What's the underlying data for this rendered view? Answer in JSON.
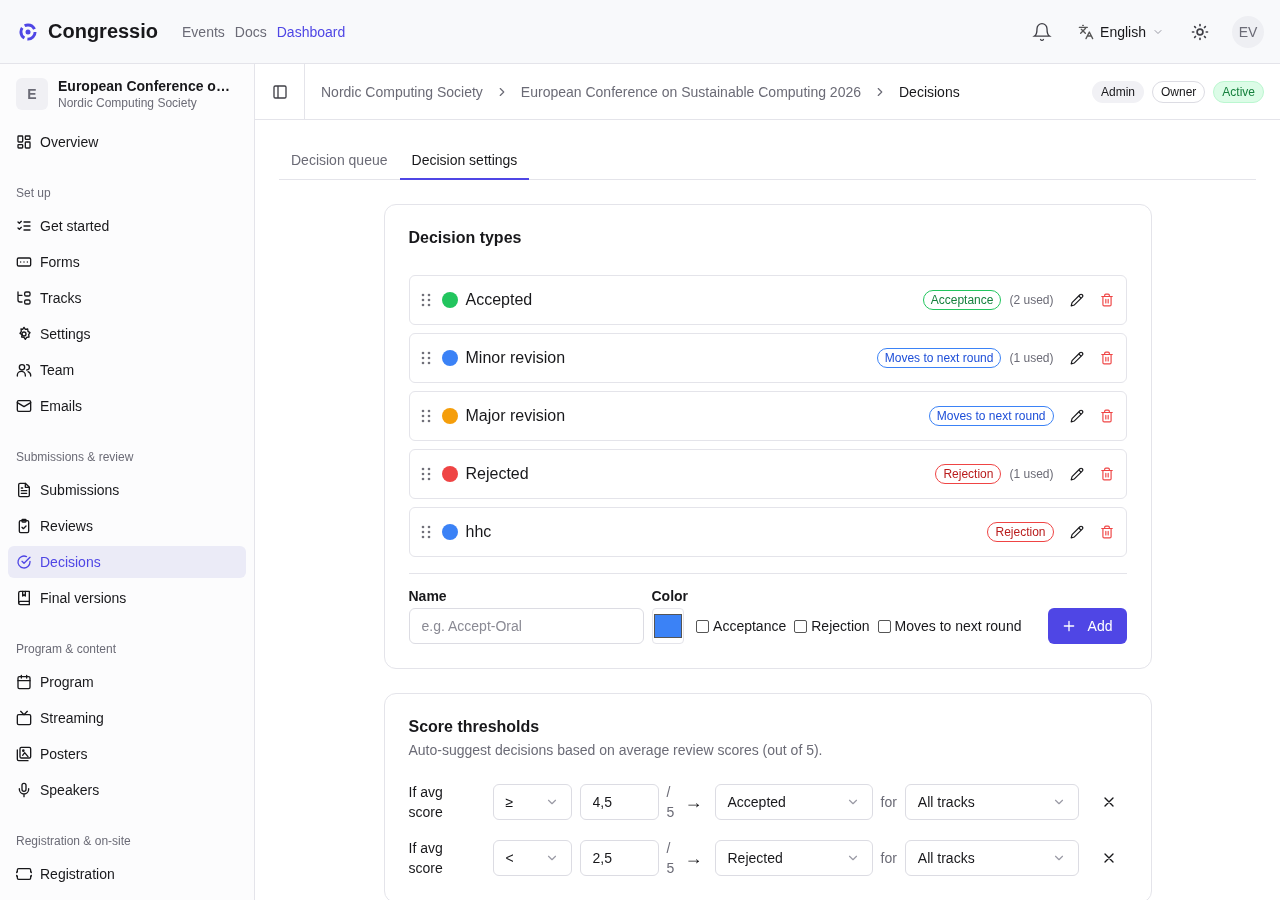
{
  "header": {
    "brand": "Congressio",
    "nav": [
      {
        "label": "Events",
        "selected": false
      },
      {
        "label": "Docs",
        "selected": false
      },
      {
        "label": "Dashboard",
        "selected": true
      }
    ],
    "language": "English",
    "avatar": "EV"
  },
  "sidebar": {
    "event": {
      "initial": "E",
      "title": "European Conference o…",
      "org": "Nordic Computing Society"
    },
    "sections": [
      {
        "items": [
          {
            "label": "Overview",
            "selected": false
          }
        ]
      },
      {
        "title": "Set up",
        "items": [
          {
            "label": "Get started",
            "selected": false
          },
          {
            "label": "Forms",
            "selected": false
          },
          {
            "label": "Tracks",
            "selected": false
          },
          {
            "label": "Settings",
            "selected": false
          },
          {
            "label": "Team",
            "selected": false
          },
          {
            "label": "Emails",
            "selected": false
          }
        ]
      },
      {
        "title": "Submissions & review",
        "items": [
          {
            "label": "Submissions",
            "selected": false
          },
          {
            "label": "Reviews",
            "selected": false
          },
          {
            "label": "Decisions",
            "selected": true
          },
          {
            "label": "Final versions",
            "selected": false
          }
        ]
      },
      {
        "title": "Program & content",
        "items": [
          {
            "label": "Program",
            "selected": false
          },
          {
            "label": "Streaming",
            "selected": false
          },
          {
            "label": "Posters",
            "selected": false
          },
          {
            "label": "Speakers",
            "selected": false
          }
        ]
      },
      {
        "title": "Registration & on-site",
        "items": [
          {
            "label": "Registration",
            "selected": false
          }
        ]
      }
    ]
  },
  "breadcrumb": [
    "Nordic Computing Society",
    "European Conference on Sustainable Computing 2026",
    "Decisions"
  ],
  "badges": [
    {
      "label": "Admin",
      "kind": "muted"
    },
    {
      "label": "Owner",
      "kind": "outline"
    },
    {
      "label": "Active",
      "kind": "success"
    }
  ],
  "tabs": [
    {
      "label": "Decision queue",
      "selected": false
    },
    {
      "label": "Decision settings",
      "selected": true
    }
  ],
  "decision_types": {
    "title": "Decision types",
    "items": [
      {
        "name": "Accepted",
        "color": "#22c55e",
        "tag": "Acceptance",
        "kind": "acceptance",
        "used": "(2 used)"
      },
      {
        "name": "Minor revision",
        "color": "#3b82f6",
        "tag": "Moves to next round",
        "kind": "next_round",
        "used": "(1 used)"
      },
      {
        "name": "Major revision",
        "color": "#f59e0b",
        "tag": "Moves to next round",
        "kind": "next_round"
      },
      {
        "name": "Rejected",
        "color": "#ef4444",
        "tag": "Rejection",
        "kind": "rejection",
        "used": "(1 used)"
      },
      {
        "name": "hhc",
        "color": "#3b82f6",
        "tag": "Rejection",
        "kind": "rejection"
      }
    ],
    "form": {
      "name_label": "Name",
      "name_placeholder": "e.g. Accept-Oral",
      "color_label": "Color",
      "color": "#3b82f6",
      "checkboxes": [
        {
          "label": "Acceptance",
          "checked": false
        },
        {
          "label": "Rejection",
          "checked": false
        },
        {
          "label": "Moves to next round",
          "checked": false
        }
      ],
      "add_button": "Add"
    }
  },
  "score_thresholds": {
    "title": "Score thresholds",
    "description": "Auto-suggest decisions based on average review scores (out of 5).",
    "rules": [
      {
        "prefix": "If avg score",
        "operator": "≥",
        "value": "4,5",
        "out_of": "/ 5",
        "arrow": "→",
        "decision": "Accepted",
        "for": "for",
        "track": "All tracks"
      },
      {
        "prefix": "If avg score",
        "operator": "<",
        "value": "2,5",
        "out_of": "/ 5",
        "arrow": "→",
        "decision": "Rejected",
        "for": "for",
        "track": "All tracks"
      }
    ]
  }
}
